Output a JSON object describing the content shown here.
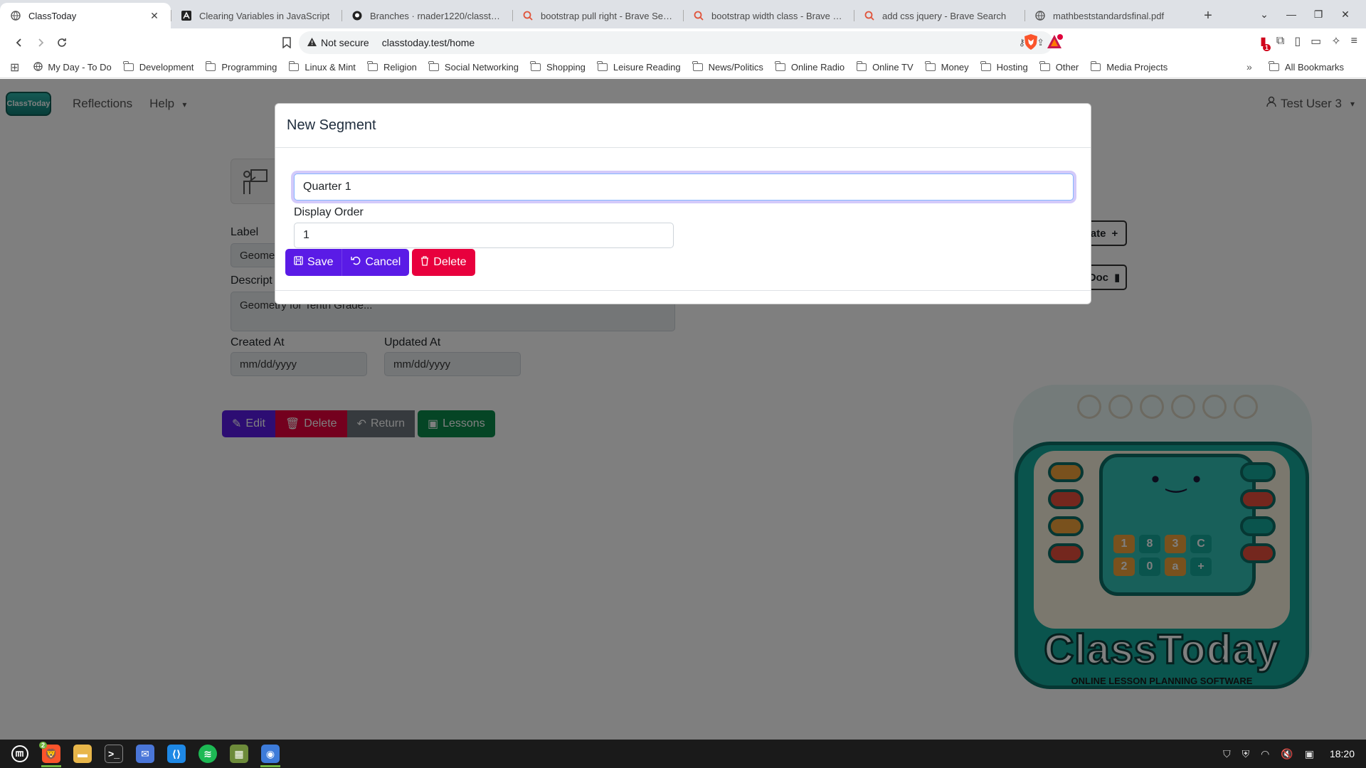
{
  "browser": {
    "tabs": [
      {
        "label": "ClassToday",
        "icon": "globe-icon",
        "active": true
      },
      {
        "label": "Clearing Variables in JavaScript",
        "icon": "a-logo-icon",
        "active": false
      },
      {
        "label": "Branches · rnader1220/classtoday",
        "icon": "github-icon",
        "active": false
      },
      {
        "label": "bootstrap pull right - Brave Search",
        "icon": "brave-search-icon",
        "active": false
      },
      {
        "label": "bootstrap width class - Brave Search",
        "icon": "brave-search-icon",
        "active": false
      },
      {
        "label": "add css jquery - Brave Search",
        "icon": "brave-search-icon",
        "active": false
      },
      {
        "label": "mathbeststandardsfinal.pdf",
        "icon": "globe-icon",
        "active": false
      }
    ],
    "close_glyph": "✕",
    "new_tab_glyph": "+",
    "address": {
      "security_label": "Not secure",
      "url": "classtoday.test/home"
    },
    "bookmarks": [
      {
        "label": "My Day - To Do",
        "type": "link"
      },
      {
        "label": "Development",
        "type": "folder"
      },
      {
        "label": "Programming",
        "type": "folder"
      },
      {
        "label": "Linux & Mint",
        "type": "folder"
      },
      {
        "label": "Religion",
        "type": "folder"
      },
      {
        "label": "Social Networking",
        "type": "folder"
      },
      {
        "label": "Shopping",
        "type": "folder"
      },
      {
        "label": "Leisure Reading",
        "type": "folder"
      },
      {
        "label": "News/Politics",
        "type": "folder"
      },
      {
        "label": "Online Radio",
        "type": "folder"
      },
      {
        "label": "Online TV",
        "type": "folder"
      },
      {
        "label": "Money",
        "type": "folder"
      },
      {
        "label": "Hosting",
        "type": "folder"
      },
      {
        "label": "Other",
        "type": "folder"
      },
      {
        "label": "Media Projects",
        "type": "folder"
      }
    ],
    "bookmarks_more_glyph": "»",
    "all_bookmarks": "All Bookmarks",
    "extension_badge": "1"
  },
  "app": {
    "logo_text": "ClassToday",
    "nav": {
      "reflections": "Reflections",
      "help": "Help",
      "user": "Test User 3"
    },
    "form": {
      "label_label": "Label",
      "label_value": "Geomet",
      "description_label": "Descript",
      "description_value": "Geometry for Tenth Grade...",
      "created_label": "Created At",
      "created_value": "mm/dd/yyyy",
      "updated_label": "Updated At",
      "updated_value": "mm/dd/yyyy"
    },
    "side_buttons": {
      "create": "ate",
      "doc": "Doc"
    },
    "actions": {
      "edit": "Edit",
      "delete": "Delete",
      "return": "Return",
      "lessons": "Lessons"
    },
    "big_logo": {
      "wordmark": "ClassToday",
      "tagline": "ONLINE LESSON PLANNING SOFTWARE",
      "keys": [
        "1",
        "8",
        "3",
        "C",
        "2",
        "0",
        "a",
        "+"
      ]
    }
  },
  "modal": {
    "title": "New Segment",
    "segment_name_value": "Quarter 1",
    "display_order_label": "Display Order",
    "display_order_value": "1",
    "buttons": {
      "save": "Save",
      "cancel": "Cancel",
      "delete": "Delete"
    }
  },
  "taskbar": {
    "apps": [
      "mint-menu-icon",
      "brave-browser-icon",
      "files-icon",
      "terminal-icon",
      "mail-icon",
      "vscode-icon",
      "spotify-icon",
      "minecraft-icon",
      "screenshot-icon"
    ],
    "browser_badge": "2",
    "clock": "18:20"
  }
}
